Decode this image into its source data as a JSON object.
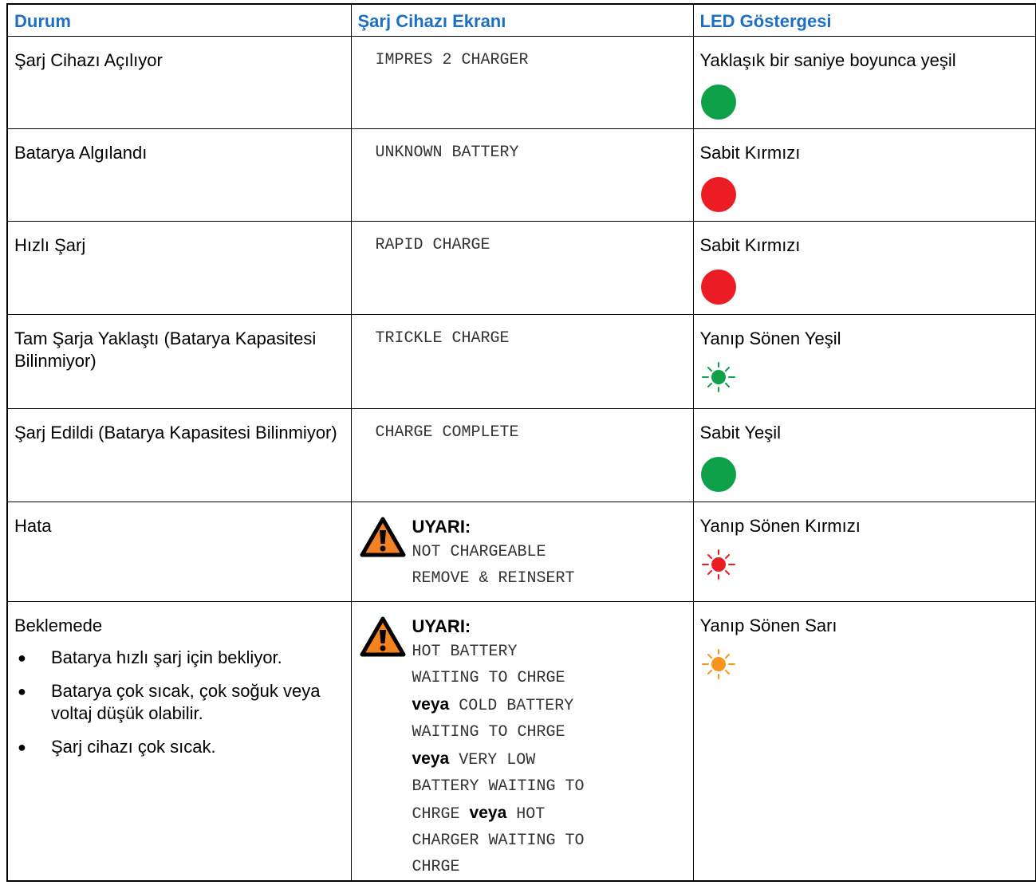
{
  "table": {
    "headers": [
      "Durum",
      "Şarj Cihazı Ekranı",
      "LED Göstergesi"
    ],
    "rows": [
      {
        "status": "Şarj Cihazı Açılıyor",
        "screen": "IMPRES 2 CHARGER",
        "led_label": "Yaklaşık bir saniye boyunca yeşil",
        "led_icon": "solid-green-led-icon",
        "led_color": "#0fa14a"
      },
      {
        "status": "Batarya Algılandı",
        "screen": "UNKNOWN BATTERY",
        "led_label": "Sabit Kırmızı",
        "led_icon": "solid-red-led-icon",
        "led_color": "#ec1c24"
      },
      {
        "status": "Hızlı Şarj",
        "screen": "RAPID CHARGE",
        "led_label": "Sabit Kırmızı",
        "led_icon": "solid-red-led-icon",
        "led_color": "#ec1c24"
      },
      {
        "status": "Tam Şarja Yaklaştı (Batarya Kapasitesi Bilinmiyor)",
        "screen": "TRICKLE CHARGE",
        "led_label": "Yanıp Sönen Yeşil",
        "led_icon": "blinking-green-led-icon",
        "led_color": "#0fa14a"
      },
      {
        "status": "Şarj Edildi (Batarya Kapasitesi Bilinmiyor)",
        "screen": "CHARGE COMPLETE",
        "led_label": "Sabit Yeşil",
        "led_icon": "solid-green-led-icon",
        "led_color": "#0fa14a"
      },
      {
        "status": "Hata",
        "warning_title": "UYARI:",
        "screen_lines": [
          "NOT CHARGEABLE",
          "REMOVE & REINSERT"
        ],
        "led_label": "Yanıp Sönen Kırmızı",
        "led_icon": "blinking-red-led-icon",
        "led_color": "#ec1c24"
      },
      {
        "status": "Beklemede",
        "bullets": [
          "Batarya hızlı şarj için bekliyor.",
          "Batarya çok sıcak, çok soğuk veya voltaj düşük olabilir.",
          "Şarj cihazı çok sıcak."
        ],
        "warning_title": "UYARI:",
        "screen_lines": [
          "HOT BATTERY",
          "WAITING TO CHRGE",
          "COLD BATTERY",
          "WAITING TO CHRGE",
          "VERY LOW",
          "BATTERY WAITING TO",
          "CHRGE",
          "HOT",
          "CHARGER WAITING TO",
          "CHRGE"
        ],
        "connector": "veya",
        "led_label": "Yanıp Sönen Sarı",
        "led_icon": "blinking-amber-led-icon",
        "led_color": "#f7941d"
      }
    ]
  },
  "warning_icon": "warning-triangle-icon",
  "warning_colors": {
    "fill": "#f58220",
    "outline": "#000000"
  }
}
